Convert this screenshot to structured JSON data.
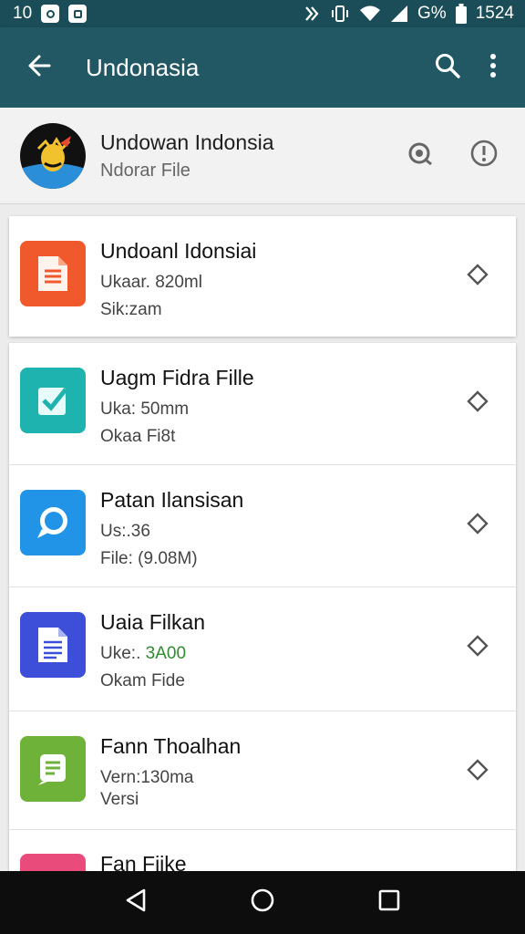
{
  "status_bar": {
    "time": "10",
    "battery_percent": "G%",
    "right_time": "1524",
    "left_icons": [
      "notification-icon",
      "notification-icon-2"
    ],
    "right_icons": [
      "nfc-icon",
      "vibrate-icon",
      "wifi-icon",
      "signal-icon",
      "battery-icon"
    ]
  },
  "app_bar": {
    "title": "Undonasia",
    "color": "#215864"
  },
  "header": {
    "title": "Undowan Indonsia",
    "subtitle": "Ndorar File"
  },
  "files": [
    {
      "title": "Undoanl Idonsiai",
      "line1": "Ukaar. 820ml",
      "line2": "Sik:zam",
      "icon": "document-icon",
      "color": "#f0592b"
    },
    {
      "title": "Uagm Fidra Fille",
      "line1": "Uka: 50mm",
      "line2": "Okaa Fi8t",
      "icon": "checkbox-icon",
      "color": "#1fb3b0"
    },
    {
      "title": "Patan Ilansisan",
      "line1": "Us:.36",
      "line2": "File: (9.08M)",
      "icon": "chat-bubble-icon",
      "color": "#2294e8"
    },
    {
      "title": "Uaia Filkan",
      "line1_prefix": "Uke:.",
      "line1_highlight": "3A00",
      "line2": "Okam Fide",
      "icon": "text-file-icon",
      "color": "#3d4fd8"
    },
    {
      "title": "Fann Thoalhan",
      "line1": "Vern:130ma",
      "line2": "Versi",
      "icon": "note-icon",
      "color": "#6fb23a"
    },
    {
      "title": "Fan Fiike",
      "icon": "file-icon",
      "color": "#e94b7a"
    }
  ],
  "highlight_color": "#2e8b2e"
}
